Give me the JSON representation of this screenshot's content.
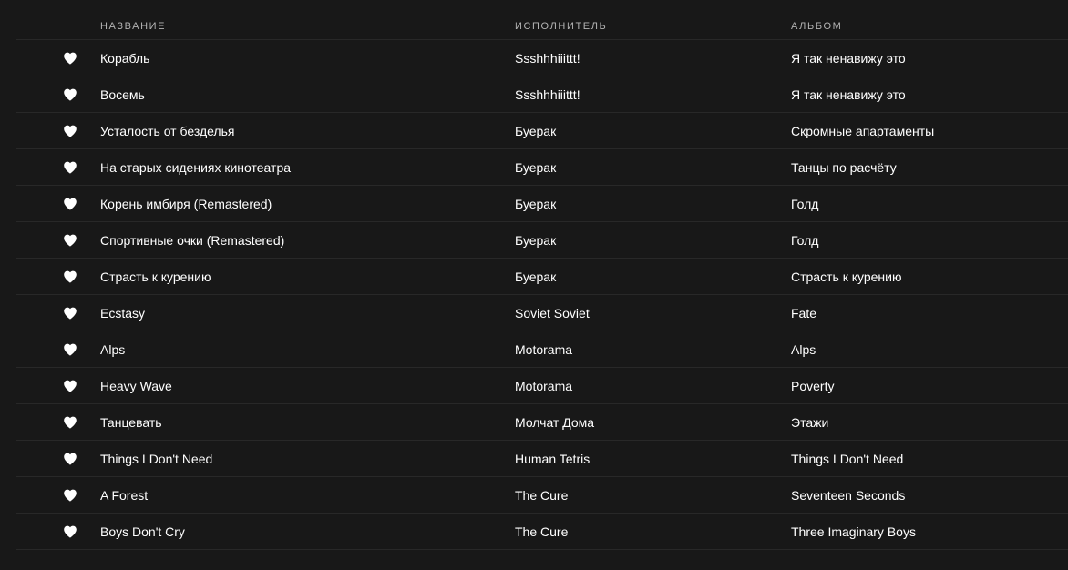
{
  "colors": {
    "background": "#181818",
    "divider": "#282828",
    "header_text": "#b3b3b3",
    "text": "#ffffff",
    "heart": "#ffffff"
  },
  "header": {
    "title": "НАЗВАНИЕ",
    "artist": "ИСПОЛНИТЕЛЬ",
    "album": "АЛЬБОМ"
  },
  "tracks": [
    {
      "title": "Корабль",
      "artist": "Ssshhhiiittt!",
      "album": "Я так ненавижу это",
      "icon": "heart-filled-icon"
    },
    {
      "title": "Восемь",
      "artist": "Ssshhhiiittt!",
      "album": "Я так ненавижу это",
      "icon": "heart-filled-icon"
    },
    {
      "title": "Усталость от безделья",
      "artist": "Буерак",
      "album": "Скромные апартаменты",
      "icon": "heart-filled-icon"
    },
    {
      "title": "На старых сидениях кинотеатра",
      "artist": "Буерак",
      "album": "Танцы по расчёту",
      "icon": "heart-filled-icon"
    },
    {
      "title": "Корень имбиря (Remastered)",
      "artist": "Буерак",
      "album": "Голд",
      "icon": "heart-filled-icon"
    },
    {
      "title": "Спортивные очки (Remastered)",
      "artist": "Буерак",
      "album": "Голд",
      "icon": "heart-filled-icon"
    },
    {
      "title": "Страсть к курению",
      "artist": "Буерак",
      "album": "Страсть к курению",
      "icon": "heart-filled-icon"
    },
    {
      "title": "Ecstasy",
      "artist": "Soviet Soviet",
      "album": "Fate",
      "icon": "heart-filled-icon"
    },
    {
      "title": "Alps",
      "artist": "Motorama",
      "album": "Alps",
      "icon": "heart-filled-icon"
    },
    {
      "title": "Heavy Wave",
      "artist": "Motorama",
      "album": "Poverty",
      "icon": "heart-filled-icon"
    },
    {
      "title": "Танцевать",
      "artist": "Молчат Дома",
      "album": "Этажи",
      "icon": "heart-filled-icon"
    },
    {
      "title": "Things I Don't Need",
      "artist": "Human Tetris",
      "album": "Things I Don't Need",
      "icon": "heart-filled-icon"
    },
    {
      "title": "A Forest",
      "artist": "The Cure",
      "album": "Seventeen Seconds",
      "icon": "heart-filled-icon"
    },
    {
      "title": "Boys Don't Cry",
      "artist": "The Cure",
      "album": "Three Imaginary Boys",
      "icon": "heart-filled-icon"
    }
  ]
}
